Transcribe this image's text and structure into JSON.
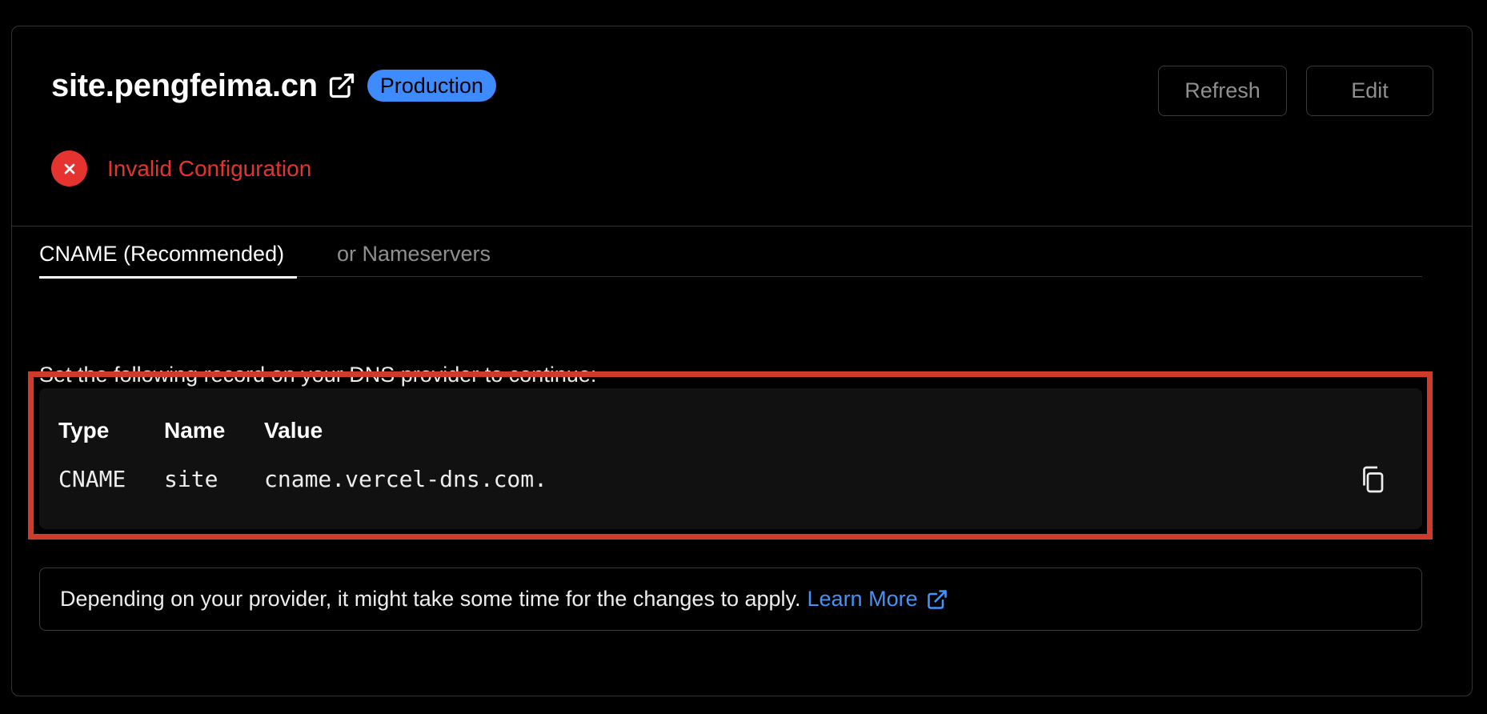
{
  "header": {
    "domain": "site.pengfeima.cn",
    "badge": "Production",
    "refresh_label": "Refresh",
    "edit_label": "Edit"
  },
  "status": {
    "text": "Invalid Configuration",
    "color": "#e5342f"
  },
  "tabs": [
    {
      "label": "CNAME (Recommended)",
      "active": true
    },
    {
      "label": "or Nameservers",
      "active": false
    }
  ],
  "instruction": "Set the following record on your DNS provider to continue:",
  "record": {
    "headers": [
      "Type",
      "Name",
      "Value"
    ],
    "values": [
      "CNAME",
      "site",
      "cname.vercel-dns.com."
    ]
  },
  "note": {
    "text": "Depending on your provider, it might take some time for the changes to apply.",
    "link_label": "Learn More"
  },
  "colors": {
    "accent_blue": "#3d8bfd",
    "link_blue": "#4493f8",
    "error_red": "#e5342f",
    "highlight_red": "#cf3a2b"
  }
}
